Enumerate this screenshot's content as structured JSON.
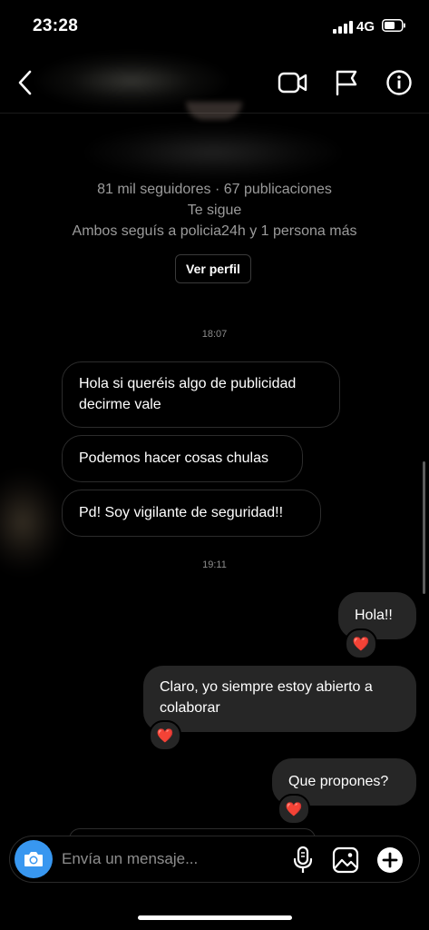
{
  "status_bar": {
    "time": "23:28",
    "network": "4G"
  },
  "header": {
    "back_icon": "chevron-left-icon",
    "video_icon": "video-camera-icon",
    "flag_icon": "flag-icon",
    "info_icon": "info-icon"
  },
  "profile": {
    "stats": "81 mil seguidores · 67 publicaciones",
    "follows_you": "Te sigue",
    "mutual": "Ambos seguís a policia24h y 1 persona más",
    "view_profile_label": "Ver perfil"
  },
  "messages": {
    "timestamp_1": "18:07",
    "incoming": [
      {
        "line1": "Hola si queréis algo de publicidad",
        "line2": "decirme vale"
      },
      {
        "line1": "Podemos hacer cosas chulas"
      },
      {
        "line1": "Pd! Soy vigilante de seguridad!!"
      }
    ],
    "timestamp_2": "19:11",
    "outgoing": [
      {
        "line1": "Hola!!",
        "reaction": "❤️"
      },
      {
        "line1": "Claro, yo siempre estoy abierto a",
        "line2": "colaborar",
        "reaction": "❤️"
      },
      {
        "line1": "Que propones?",
        "reaction": "❤️"
      }
    ]
  },
  "composer": {
    "placeholder": "Envía un mensaje...",
    "camera_icon": "camera-icon",
    "mic_icon": "microphone-icon",
    "gallery_icon": "image-icon",
    "plus_icon": "plus-icon"
  },
  "colors": {
    "accent": "#3897f0",
    "outgoing_bubble": "#262626",
    "heart": "#e0245e"
  }
}
